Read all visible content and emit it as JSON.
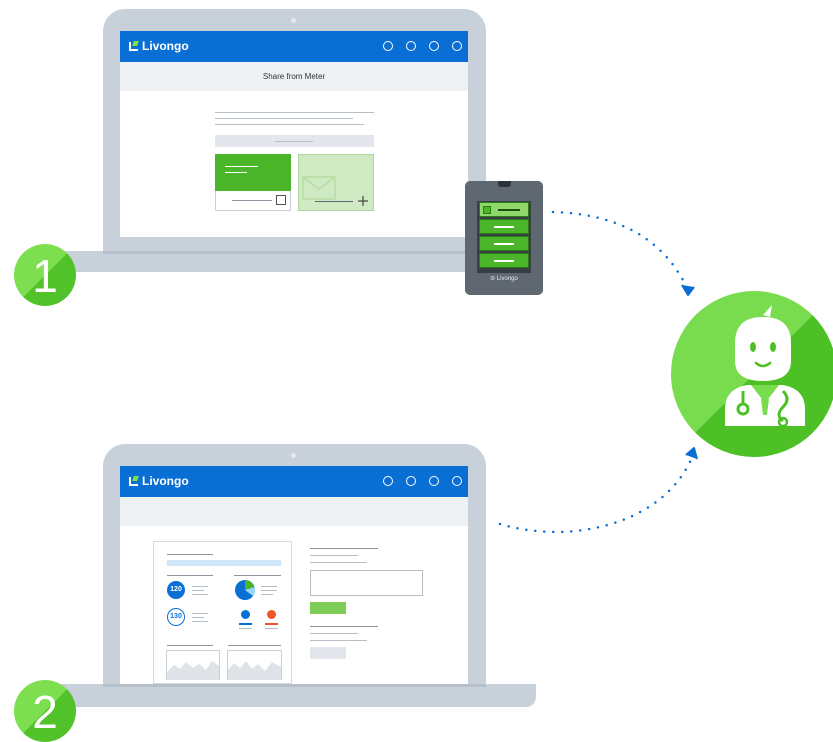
{
  "brand": {
    "name": "Livongo"
  },
  "steps": [
    {
      "number": "1"
    },
    {
      "number": "2"
    }
  ],
  "laptop1": {
    "subheader": "Share from Meter",
    "header_icons": [
      "circle-icon",
      "circle-icon",
      "circle-icon",
      "circle-icon"
    ]
  },
  "laptop2": {
    "header_icons": [
      "circle-icon",
      "circle-icon",
      "circle-icon",
      "circle-icon"
    ],
    "report": {
      "reading_1": "120",
      "reading_2": "130"
    }
  },
  "meter": {
    "brand": "Livongo"
  },
  "colors": {
    "header_blue": "#0a6fd4",
    "brand_green": "#4cc024",
    "light_green": "#79dc4e",
    "laptop_gray": "#c8d1da",
    "dotted_path": "#0a6fd4"
  }
}
